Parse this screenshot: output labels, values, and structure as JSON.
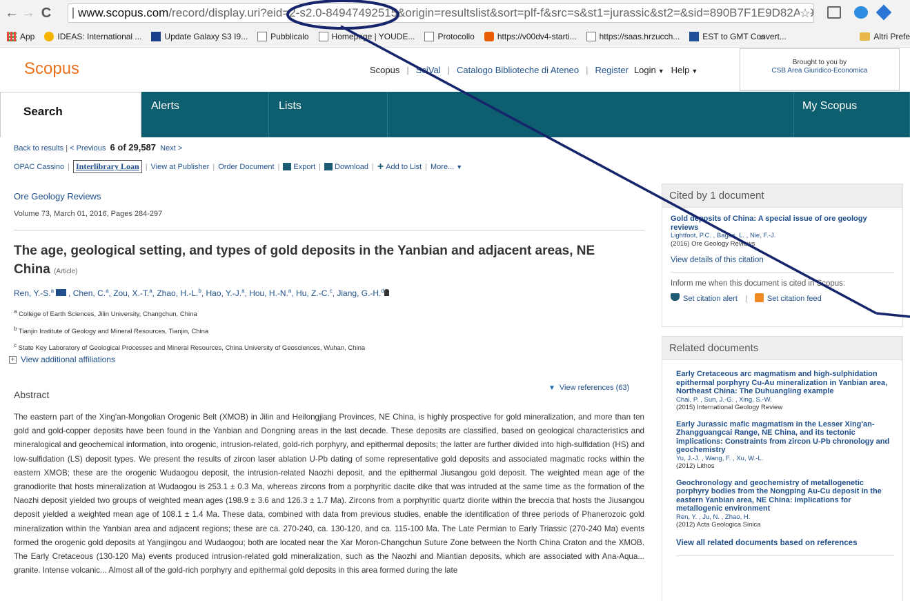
{
  "browser": {
    "url_domain": "www.scopus.com",
    "url_rest": "/record/display.uri?eid=2-s2.0-84947492515&origin=resultslist&sort=plf-f&src=s&st1=jurassic&st2=&sid=890B7F1E9D82A59(",
    "bookmarks": [
      {
        "label": "App",
        "icon": "apps-icon"
      },
      {
        "label": "IDEAS: International ...",
        "icon": "bulb-icon"
      },
      {
        "label": "Update Galaxy S3 I9...",
        "icon": "bit-icon"
      },
      {
        "label": "Pubblicalo",
        "icon": "page-icon"
      },
      {
        "label": "Homepage | YOUDE...",
        "icon": "page-icon"
      },
      {
        "label": "Protocollo",
        "icon": "page-icon"
      },
      {
        "label": "https://v00dv4-starti...",
        "icon": "cp-icon"
      },
      {
        "label": "https://saas.hrzucch...",
        "icon": "page-icon"
      },
      {
        "label": "EST to GMT Convert...",
        "icon": "est-icon"
      }
    ],
    "more": "»",
    "other_bookmarks": "Altri Prefe"
  },
  "header": {
    "logo": "Scopus",
    "nav": {
      "scopus": "Scopus",
      "scival": "SciVal",
      "catalogo": "Catalogo Biblioteche di Ateneo",
      "register": "Register",
      "login": "Login",
      "help": "Help"
    },
    "brought_by": "Brought to you by",
    "institution": "CSB Area Giuridico-Economica"
  },
  "tabs": [
    "Search",
    "Alerts",
    "Lists",
    "My Scopus"
  ],
  "results_nav": {
    "back": "Back to results",
    "previous": "< Previous",
    "position": "6 of 29,587",
    "next": "Next >"
  },
  "actions": {
    "opac": "OPAC Cassino",
    "ill": "Interlibrary Loan",
    "publisher": "View at Publisher",
    "order": "Order Document",
    "export": "Export",
    "download": "Download",
    "add_list": "Add to List",
    "more": "More..."
  },
  "article": {
    "journal": "Ore Geology Reviews",
    "volume": "Volume 73, March 01, 2016, Pages 284-297",
    "title": "The age, geological setting, and types of gold deposits in the Yanbian and adjacent areas, NE China",
    "type": "(Article)",
    "authors": [
      {
        "name": "Ren, Y.-S.",
        "sup": "a"
      },
      {
        "name": "Chen, C.",
        "sup": "a"
      },
      {
        "name": "Zou, X.-T.",
        "sup": "a"
      },
      {
        "name": "Zhao, H.-L.",
        "sup": "b"
      },
      {
        "name": "Hao, Y.-J.",
        "sup": "a"
      },
      {
        "name": "Hou, H.-N.",
        "sup": "a"
      },
      {
        "name": "Hu, Z.-C.",
        "sup": "c"
      },
      {
        "name": "Jiang, G.-H.",
        "sup": "d"
      }
    ],
    "affiliations": [
      {
        "sup": "a",
        "text": "College of Earth Sciences, Jilin University, Changchun, China"
      },
      {
        "sup": "b",
        "text": "Tianjin Institute of Geology and Mineral Resources, Tianjin, China"
      },
      {
        "sup": "c",
        "text": "State Key Laboratory of Geological Processes and Mineral Resources, China University of Geosciences, Wuhan, China"
      }
    ],
    "more_affiliations": "View additional affiliations",
    "view_refs": "View references (63)",
    "abstract_heading": "Abstract",
    "abstract": "The eastern part of the Xing'an-Mongolian Orogenic Belt (XMOB) in Jilin and Heilongjiang Provinces, NE China, is highly prospective for gold mineralization, and more than ten gold and gold-copper deposits have been found in the Yanbian and Dongning areas in the last decade. These deposits are classified, based on geological characteristics and mineralogical and geochemical information, into orogenic, intrusion-related, gold-rich porphyry, and epithermal deposits; the latter are further divided into high-sulfidation (HS) and low-sulfidation (LS) deposit types. We present the results of zircon laser ablation U-Pb dating of some representative gold deposits and associated magmatic rocks within the eastern XMOB; these are the orogenic Wudaogou deposit, the intrusion-related Naozhi deposit, and the epithermal Jiusangou gold deposit. The weighted mean age of the granodiorite that hosts mineralization at Wudaogou is 253.1 ± 0.3 Ma, whereas zircons from a porphyritic dacite dike that was intruded at the same time as the formation of the Naozhi deposit yielded two groups of weighted mean ages (198.9 ± 3.6 and 126.3 ± 1.7 Ma). Zircons from a porphyritic quartz diorite within the breccia that hosts the Jiusangou deposit yielded a weighted mean age of 108.1 ± 1.4 Ma. These data, combined with data from previous studies, enable the identification of three periods of Phanerozoic gold mineralization within the Yanbian area and adjacent regions; these are ca. 270-240, ca. 130-120, and ca. 115-100 Ma. The Late Permian to Early Triassic (270-240 Ma) events formed the orogenic gold deposits at Yangjingou and Wudaogou; both are located near the Xar Moron-Changchun Suture Zone between the North China Craton and the XMOB. The Early Cretaceous (130-120 Ma) events produced intrusion-related gold mineralization, such as the Naozhi and Miantian deposits, which are associated with Ana-Aqua... granite. Intense volcanic... Almost all of the gold-rich porphyry and epithermal gold deposits in this area formed during the late"
  },
  "cited": {
    "heading": "Cited by 1 document",
    "doc_title": "Gold deposits of China: A special issue of ore geology reviews",
    "doc_authors": "Lightfoot, P.C. , Bagas, L. , Nie, F.-J.",
    "doc_source": "(2016) Ore Geology Reviews",
    "view_details": "View details of this citation",
    "inform": "Inform me when this document is cited in Scopus:",
    "set_alert": "Set citation alert",
    "set_feed": "Set citation feed"
  },
  "related": {
    "heading": "Related documents",
    "docs": [
      {
        "title": "Early Cretaceous arc magmatism and high-sulphidation epithermal porphyry Cu-Au mineralization in Yanbian area, Northeast China: The Duhuangling example",
        "authors": "Chai, P. , Sun, J.-G. , Xing, S.-W.",
        "source": "(2015) International Geology Review"
      },
      {
        "title": "Early Jurassic mafic magmatism in the Lesser Xing'an-Zhangguangcai Range, NE China, and its tectonic implications: Constraints from zircon U-Pb chronology and geochemistry",
        "authors": "Yu, J.-J. , Wang, F. , Xu, W.-L.",
        "source": "(2012) Lithos"
      },
      {
        "title": "Geochronology and geochemistry of metallogenetic porphyry bodies from the Nongping Au-Cu deposit in the eastern Yanbian area, NE China: Implications for metallogenic environment",
        "authors": "Ren, Y. , Ju, N. , Zhao, H.",
        "source": "(2012) Acta Geologica Sinica"
      }
    ],
    "view_all": "View all related documents based on references"
  },
  "colors": {
    "brand_orange": "#e9711c",
    "nav_teal": "#0d5e6e",
    "link_blue": "#1f4f8a",
    "annotation_navy": "#16256b"
  }
}
